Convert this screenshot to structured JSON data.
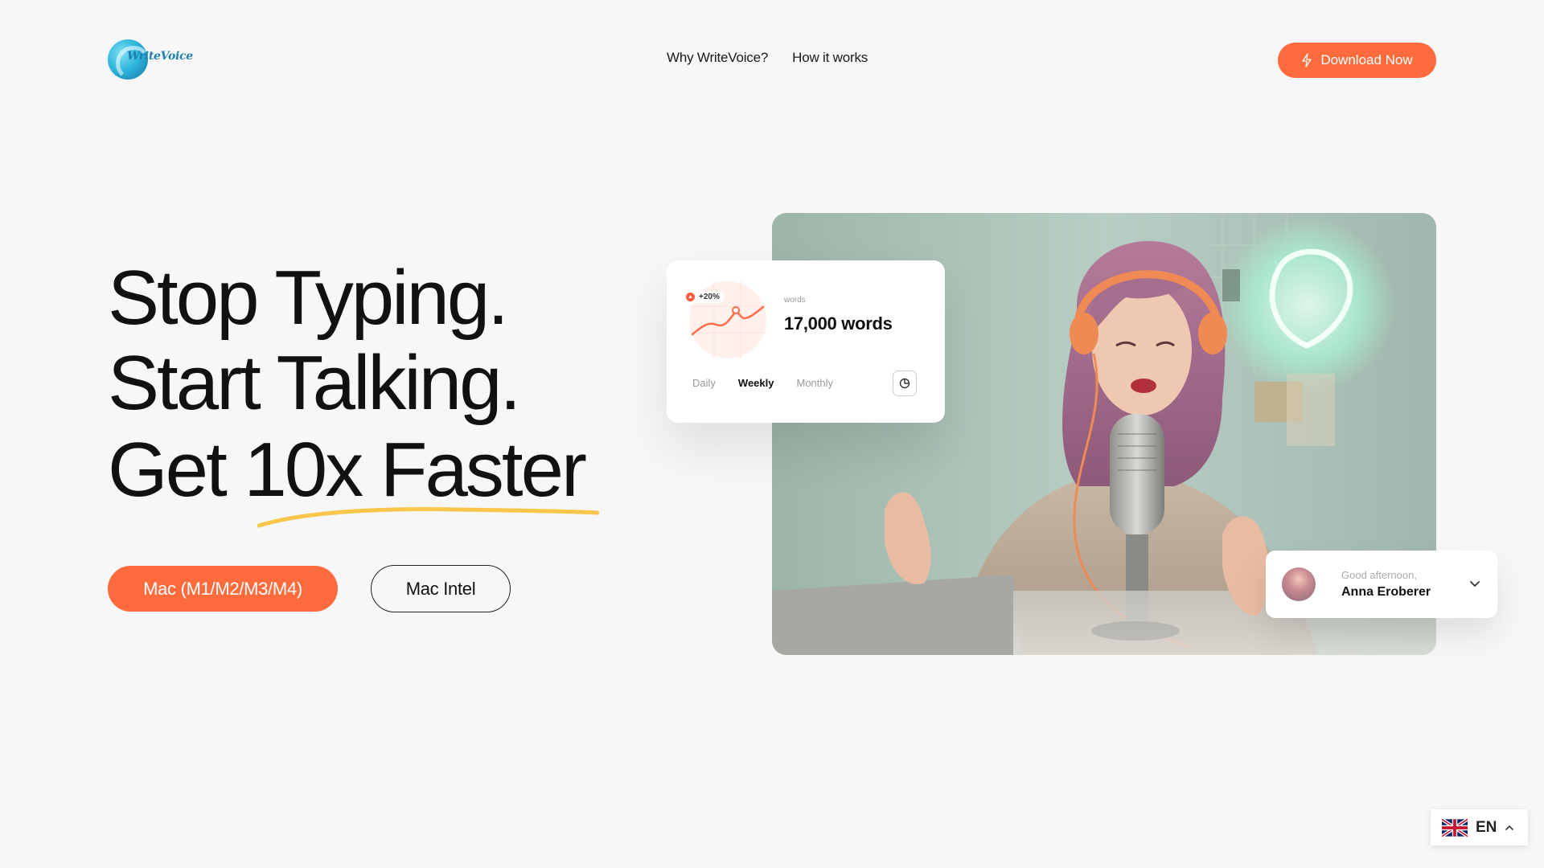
{
  "header": {
    "logo_text": "WriteVoice",
    "nav": [
      {
        "label": "Why WriteVoice?"
      },
      {
        "label": "How it works"
      }
    ],
    "download_label": "Download Now"
  },
  "hero": {
    "line1": "Stop Typing.",
    "line2": "Start Talking.",
    "line3_prefix": "Get ",
    "line3_highlight": "10x Faster",
    "btn_primary": "Mac (M1/M2/M3/M4)",
    "btn_secondary": "Mac Intel"
  },
  "stats_card": {
    "growth": "+20%",
    "words_label": "words",
    "words_value": "17,000 words",
    "tabs": [
      "Daily",
      "Weekly",
      "Monthly"
    ],
    "active_tab": "Weekly",
    "icon": "pie-chart-icon"
  },
  "greeting_card": {
    "greeting": "Good afternoon,",
    "name": "Anna Eroberer"
  },
  "language": {
    "code": "EN",
    "flag": "uk-flag-icon"
  },
  "colors": {
    "accent": "#ff6b3d",
    "underline": "#f7c64a",
    "background": "#f7f7f7"
  }
}
